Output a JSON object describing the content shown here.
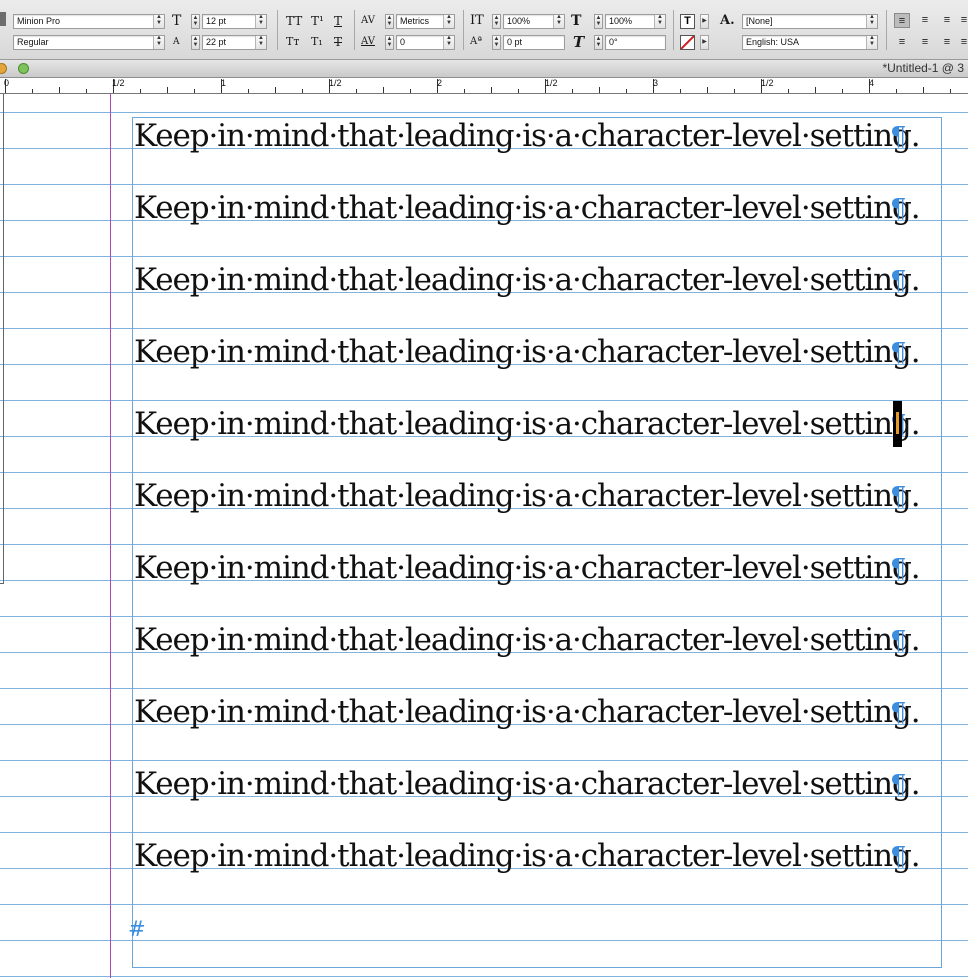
{
  "control_panel": {
    "font_family": "Minion Pro",
    "font_style": "Regular",
    "font_size": "12 pt",
    "leading": "22 pt",
    "kerning": "Metrics",
    "tracking": "0",
    "vertical_scale": "100%",
    "horizontal_scale": "100%",
    "baseline_shift": "0 pt",
    "skew": "0°",
    "character_style": "[None]",
    "language": "English: USA"
  },
  "window": {
    "title": "*Untitled-1 @ 3"
  },
  "ruler": {
    "labels": [
      "0",
      "1/2",
      "1",
      "1/2",
      "2",
      "1/2",
      "3",
      "1/2",
      "4"
    ]
  },
  "document": {
    "lines": [
      "Keep·in·mind·that·leading·is·a·character-level·setting.",
      "Keep·in·mind·that·leading·is·a·character-level·setting.",
      "Keep·in·mind·that·leading·is·a·character-level·setting.",
      "Keep·in·mind·that·leading·is·a·character-level·setting.",
      "Keep·in·mind·that·leading·is·a·character-level·setting.",
      "Keep·in·mind·that·leading·is·a·character-level·setting.",
      "Keep·in·mind·that·leading·is·a·character-level·setting.",
      "Keep·in·mind·that·leading·is·a·character-level·setting.",
      "Keep·in·mind·that·leading·is·a·character-level·setting.",
      "Keep·in·mind·that·leading·is·a·character-level·setting.",
      "Keep·in·mind·that·leading·is·a·character-level·setting."
    ],
    "pilcrow": "¶",
    "end_of_story": "#"
  },
  "colors": {
    "baseline_grid": "#7fb2dd",
    "margin_guide": "#b14ab3",
    "invisibles": "#3a8ee0",
    "cursor": "#000000"
  }
}
